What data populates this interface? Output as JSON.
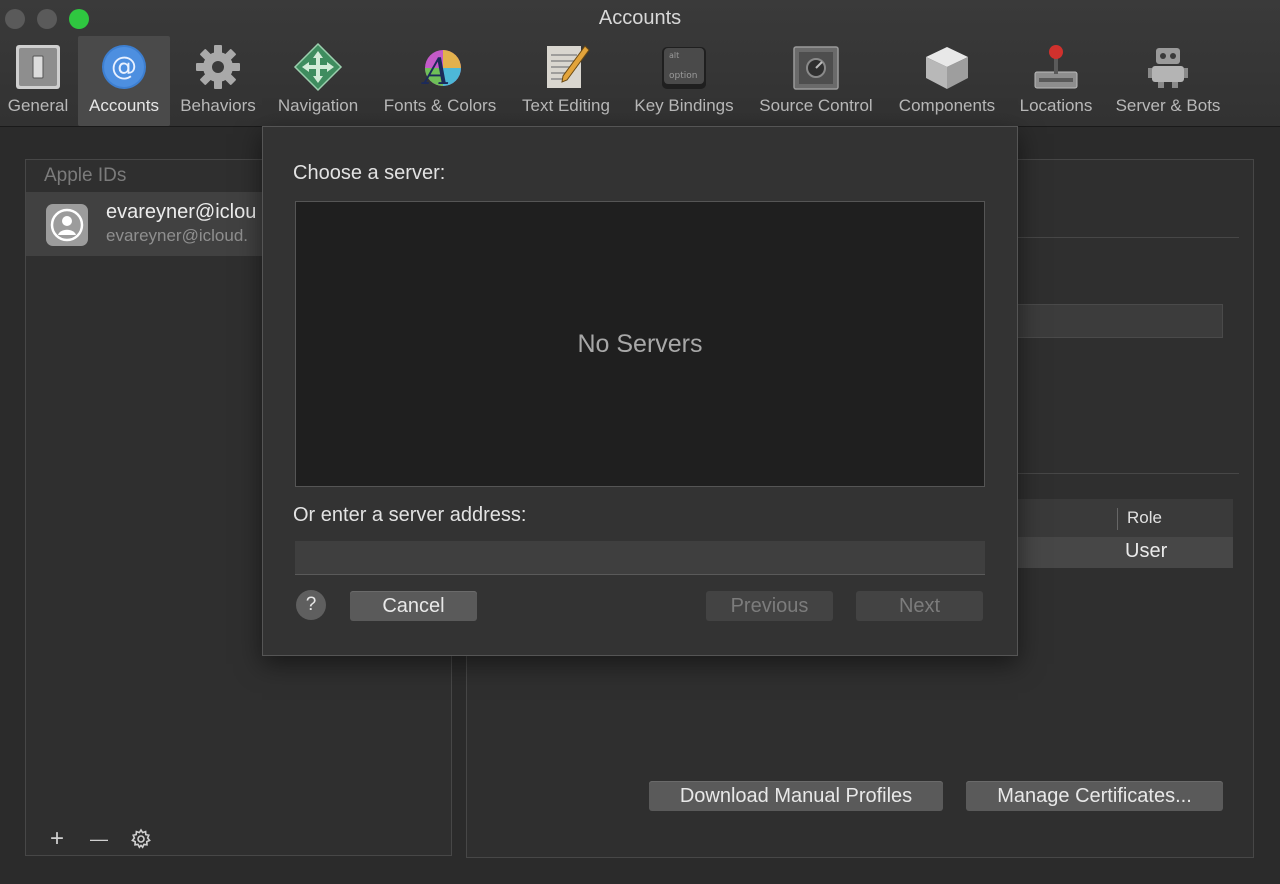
{
  "window": {
    "title": "Accounts"
  },
  "toolbar": {
    "items": [
      {
        "label": "General",
        "icon": "switch-icon"
      },
      {
        "label": "Accounts",
        "icon": "at-sign-icon"
      },
      {
        "label": "Behaviors",
        "icon": "gear-icon"
      },
      {
        "label": "Navigation",
        "icon": "arrows-icon"
      },
      {
        "label": "Fonts & Colors",
        "icon": "font-palette-icon"
      },
      {
        "label": "Text Editing",
        "icon": "pencil-paper-icon"
      },
      {
        "label": "Key Bindings",
        "icon": "option-key-icon"
      },
      {
        "label": "Source Control",
        "icon": "safe-icon"
      },
      {
        "label": "Components",
        "icon": "cube-icon"
      },
      {
        "label": "Locations",
        "icon": "joystick-drive-icon"
      },
      {
        "label": "Server & Bots",
        "icon": "robot-icon"
      }
    ],
    "selected": "Accounts"
  },
  "sidebar": {
    "header": "Apple IDs",
    "accounts": [
      {
        "name": "evareyner@iclou",
        "email": "evareyner@icloud."
      }
    ],
    "tools": {
      "add": "+",
      "remove": "—",
      "settings": "gear-icon"
    }
  },
  "detail": {
    "table": {
      "column_role": "Role",
      "row_role": "User"
    },
    "download_button": "Download Manual Profiles",
    "manage_button": "Manage Certificates..."
  },
  "sheet": {
    "choose_label": "Choose a server:",
    "empty_text": "No Servers",
    "address_label": "Or enter a server address:",
    "address_value": "",
    "help": "?",
    "cancel": "Cancel",
    "previous": "Previous",
    "next": "Next"
  }
}
